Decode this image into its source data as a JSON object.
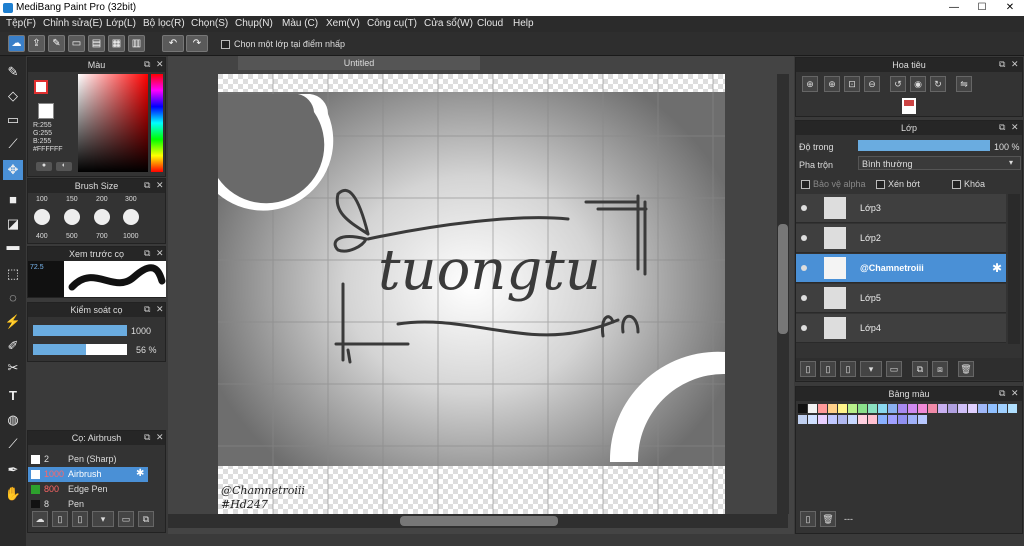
{
  "window": {
    "title": "MediBang Paint Pro (32bit)"
  },
  "menu": [
    "Tệp(F)",
    "Chỉnh sửa(E)",
    "Lớp(L)",
    "Bộ lọc(R)",
    "Chọn(S)",
    "Chụp(N)",
    "Màu (C)",
    "Xem(V)",
    "Công cụ(T)",
    "Cửa sổ(W)",
    "Cloud",
    "Help"
  ],
  "toolbar": {
    "select_one_layer_label": "Chọn một lớp tại điểm nhấp"
  },
  "color_panel": {
    "title": "Màu",
    "r": "R:255",
    "g": "G:255",
    "b": "B:255",
    "hex": "#FFFFFF"
  },
  "brush_size_panel": {
    "title": "Brush Size",
    "sizes": [
      "100",
      "150",
      "200",
      "300",
      "400",
      "500",
      "700",
      "1000"
    ]
  },
  "preview_panel": {
    "title": "Xem trước cọ",
    "value": "72.5"
  },
  "brush_control_panel": {
    "title": "Kiểm soát cọ",
    "size_value": "1000",
    "opacity_value": "56 %",
    "size_level": 1.0,
    "opacity_level": 0.56
  },
  "brush_list_panel": {
    "title": "Cọ: Airbrush",
    "items": [
      {
        "size": "2",
        "name": "Pen (Sharp)",
        "color": "#ffffff"
      },
      {
        "size": "1000",
        "name": "Airbrush",
        "color": "#ffffff",
        "selected": true
      },
      {
        "size": "800",
        "name": "Edge Pen",
        "color": "#2da02d"
      },
      {
        "size": "8",
        "name": "Pen",
        "color": "#111111"
      }
    ]
  },
  "canvas": {
    "tab_title": "Untitled",
    "art_text": "tuongtu",
    "credit_line1": "@Chamnetroiii",
    "credit_line2": "#Hd247"
  },
  "navigator_panel": {
    "title": "Hoa tiêu"
  },
  "layer_panel": {
    "title": "Lớp",
    "opacity_label": "Độ trong",
    "opacity_value": "100 %",
    "blend_label": "Pha trộn",
    "blend_value": "Bình thường",
    "protect_alpha_label": "Bảo vệ alpha",
    "clip_label": "Xén bớt",
    "lock_label": "Khóa",
    "layers": [
      {
        "name": "Lớp3"
      },
      {
        "name": "Lớp2"
      },
      {
        "name": "@Chamnetroiii",
        "selected": true
      },
      {
        "name": "Lớp5"
      },
      {
        "name": "Lớp4"
      }
    ]
  },
  "palette_panel": {
    "title": "Bảng màu",
    "footer_text": "---",
    "swatches": [
      "#111111",
      "#f3f3f3",
      "#ff9a9a",
      "#ffd08a",
      "#fff48a",
      "#b8f08a",
      "#8ae08a",
      "#8ae0c0",
      "#8ad8f0",
      "#8ab0f0",
      "#a88af0",
      "#d08af0",
      "#f08ad8",
      "#f08aa8",
      "#c8b0f0",
      "#b0a0e0",
      "#d0c0f8",
      "#e0d0ff",
      "#a0b8f8",
      "#90c0ff",
      "#a0d0ff",
      "#b0e0ff",
      "#c0d0f0",
      "#d0e0ff",
      "#e8d0ff",
      "#c0c8ff",
      "#b0b8f0",
      "#c8d8ff",
      "#ffd0e0",
      "#ffc0d0",
      "#8ab0ff",
      "#a0a0ff",
      "#9090f0",
      "#a0b0f8",
      "#b8c8ff"
    ]
  },
  "colors": {
    "accent": "#5b9bd5",
    "panel_bg": "#333333",
    "selected_row": "#4a90d6"
  }
}
